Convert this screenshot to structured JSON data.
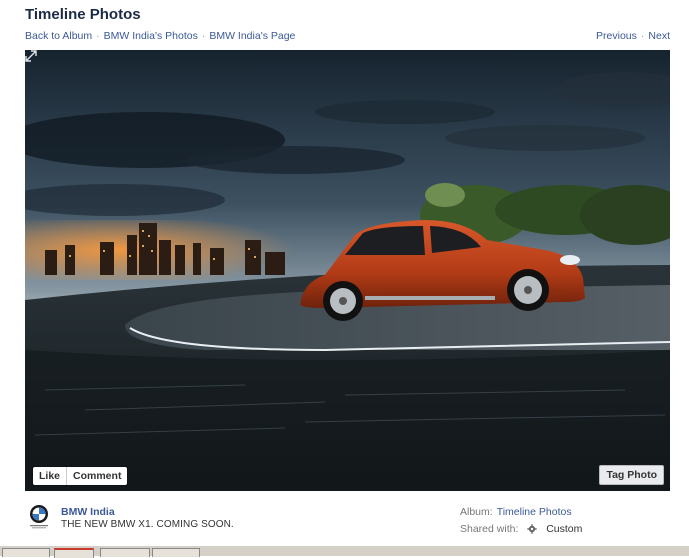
{
  "header": {
    "title": "Timeline Photos",
    "breadcrumbs": [
      "Back to Album",
      "BMW India's Photos",
      "BMW India's Page"
    ],
    "separator": "·",
    "prev_label": "Previous",
    "next_label": "Next"
  },
  "photo": {
    "like_label": "Like",
    "comment_label": "Comment",
    "tag_label": "Tag Photo",
    "expand_icon": "expand-icon"
  },
  "footer": {
    "owner_name": "BMW India",
    "caption": "THE NEW BMW X1. COMING SOON.",
    "album_label": "Album:",
    "album_value": "Timeline Photos",
    "shared_label": "Shared with:",
    "shared_value": "Custom",
    "shared_icon": "gear-icon"
  },
  "colors": {
    "link": "#3b5998",
    "title": "#1c2a47",
    "car": "#c8471f"
  }
}
